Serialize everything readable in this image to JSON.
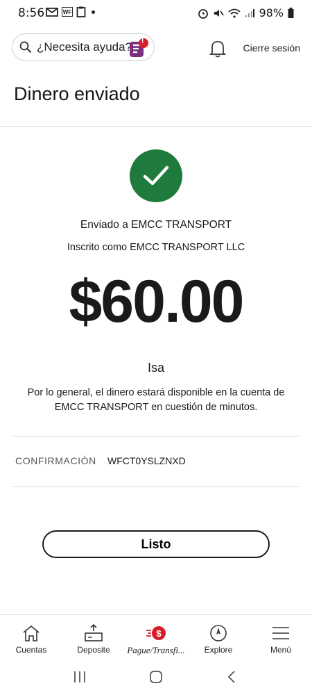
{
  "status_bar": {
    "time": "8:56",
    "battery": "98%",
    "wf_badge": "WF"
  },
  "header": {
    "search_label": "¿Necesita ayuda?",
    "fargo_badge": "!",
    "logout_label": "Cierre sesión"
  },
  "page": {
    "title": "Dinero enviado"
  },
  "confirmation_screen": {
    "sent_to": "Enviado a EMCC TRANSPORT",
    "enrolled_as": "Inscrito como EMCC TRANSPORT LLC",
    "amount": "$60.00",
    "memo": "Isa",
    "availability_line1": "Por lo general, el dinero estará disponible en la cuenta de",
    "availability_line2": "EMCC TRANSPORT en cuestión de minutos.",
    "confirmation_label": "CONFIRMACIÓN",
    "confirmation_number": "WFCT0YSLZNXD",
    "done_label": "Listo"
  },
  "colors": {
    "success_green": "#1f7a3d",
    "brand_red": "#d71e28",
    "fargo_purple": "#7b2f7e"
  },
  "bottom_nav": {
    "items": [
      {
        "label": "Cuentas",
        "icon": "home-icon"
      },
      {
        "label": "Deposite",
        "icon": "deposit-icon"
      },
      {
        "label": "Pague/Transfi...",
        "icon": "pay-transfer-icon"
      },
      {
        "label": "Explore",
        "icon": "compass-icon"
      },
      {
        "label": "Menú",
        "icon": "menu-icon"
      }
    ]
  }
}
